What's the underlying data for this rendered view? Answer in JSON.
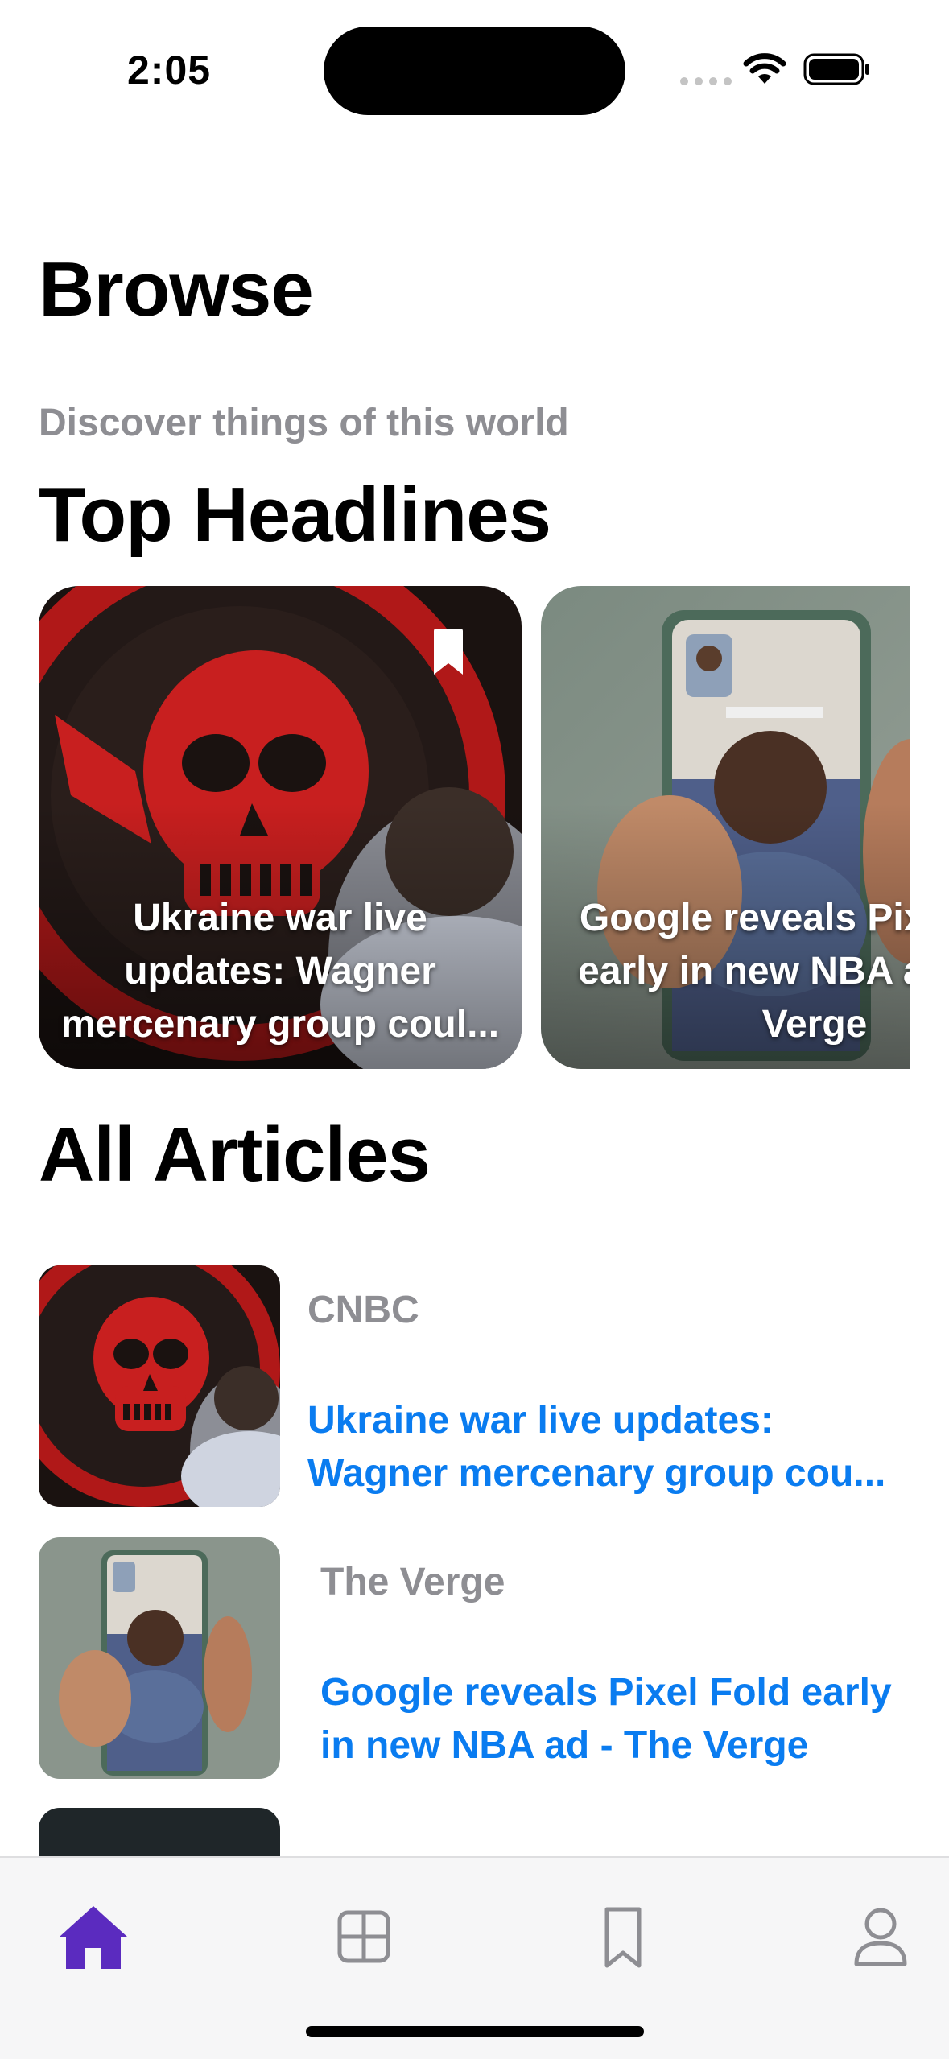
{
  "status_bar": {
    "time": "2:05"
  },
  "header": {
    "title": "Browse",
    "subtitle": "Discover things of this world"
  },
  "top_headlines": {
    "title": "Top Headlines",
    "cards": [
      {
        "title": "Ukraine war live updates: Wagner mercenary group coul...",
        "bookmarked": true
      },
      {
        "title": "Google reveals Pixel Fold early in new NBA ad - The Verge",
        "bookmarked": false
      }
    ]
  },
  "all_articles": {
    "title": "All Articles",
    "items": [
      {
        "source": "CNBC",
        "headline": "Ukraine war live updates: Wagner mercenary group cou..."
      },
      {
        "source": "The Verge",
        "headline": "Google reveals Pixel Fold early in new NBA ad - The Verge"
      }
    ]
  },
  "tab_bar": {
    "tabs": [
      {
        "icon": "home-icon",
        "active": true
      },
      {
        "icon": "grid-icon",
        "active": false
      },
      {
        "icon": "bookmark-icon",
        "active": false
      },
      {
        "icon": "person-icon",
        "active": false
      }
    ]
  },
  "colors": {
    "accent": "#5b2bbf",
    "link": "#0a7cf0",
    "secondary_text": "#8e8e93",
    "tab_inactive": "#8e8e93"
  }
}
